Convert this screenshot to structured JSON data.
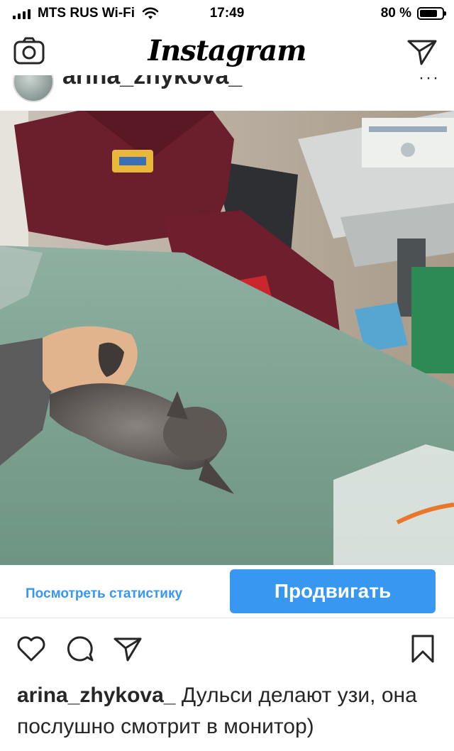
{
  "status_bar": {
    "carrier": "MTS RUS Wi-Fi",
    "time": "17:49",
    "battery_percent": "80 %",
    "battery_level": 0.8
  },
  "header": {
    "brand": "Instagram",
    "left_icon": "camera-icon",
    "right_icon": "direct-send-icon"
  },
  "post": {
    "username": "arina_zhykova_",
    "more": "···",
    "photo_description_icon": "photo"
  },
  "promo": {
    "stats_link": "Посмотреть статистику",
    "promote_button": "Продвигать"
  },
  "actions": {
    "like_icon": "heart-icon",
    "comment_icon": "comment-icon",
    "share_icon": "share-icon",
    "save_icon": "bookmark-icon"
  },
  "caption": {
    "username": "arina_zhykova_",
    "text": "Дульси делают узи, она послушно смотрит в монитор)"
  },
  "colors": {
    "accent": "#3897f0",
    "text": "#262626"
  }
}
